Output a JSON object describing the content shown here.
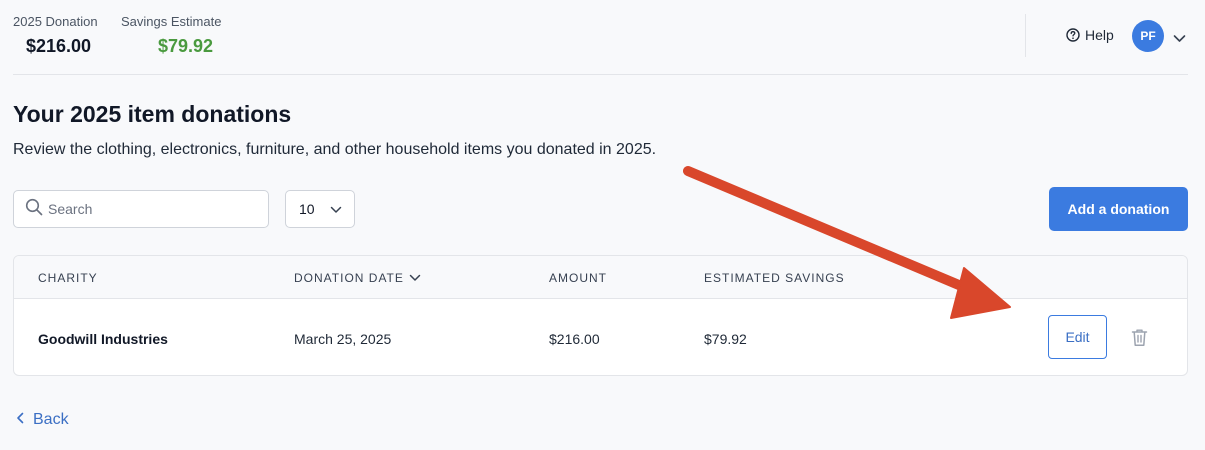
{
  "header": {
    "stats": [
      {
        "label": "2025 Donation",
        "value": "$216.00"
      },
      {
        "label": "Savings Estimate",
        "value": "$79.92"
      }
    ],
    "help_label": "Help",
    "user_initials": "PF"
  },
  "page": {
    "title": "Your 2025 item donations",
    "subtitle": "Review the clothing, electronics, furniture, and other household items you donated in 2025."
  },
  "toolbar": {
    "search_placeholder": "Search",
    "per_page": "10",
    "add_label": "Add a donation"
  },
  "table": {
    "columns": [
      "CHARITY",
      "DONATION DATE",
      "AMOUNT",
      "ESTIMATED SAVINGS"
    ],
    "sorted_column": "DONATION DATE",
    "rows": [
      {
        "charity": "Goodwill Industries",
        "date": "March 25, 2025",
        "amount": "$216.00",
        "savings": "$79.92",
        "edit_label": "Edit"
      }
    ]
  },
  "nav": {
    "back_label": "Back"
  },
  "colors": {
    "accent": "#3b7be0",
    "savings_green": "#4a9a3f",
    "annotation_arrow": "#d9472b"
  },
  "icons": [
    "help-circle-icon",
    "chevron-down-icon",
    "search-icon",
    "trash-icon",
    "chevron-left-icon",
    "annotation-arrow"
  ]
}
